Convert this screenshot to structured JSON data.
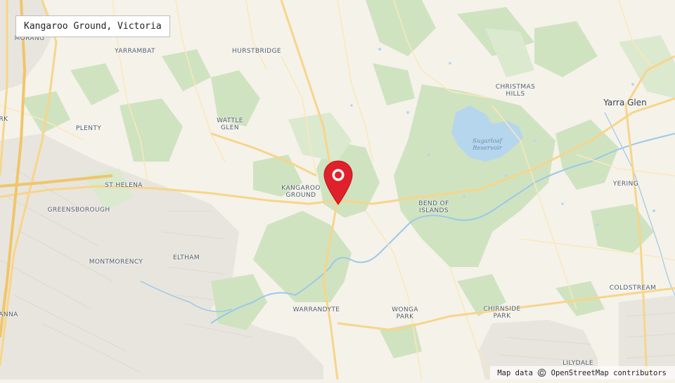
{
  "title": "Kangaroo Ground, Victoria",
  "attribution": "Map data ©️ OpenStreetMap contributors",
  "marker": {
    "label": "Kangaroo Ground",
    "color": "#e0212c",
    "icon": "map-pin-icon"
  },
  "reservoir": "Sugarloaf\nReservoir",
  "places": {
    "morang": "MORANG",
    "yarrambat": "YARRAMBAT",
    "hurstbridge": "HURSTBRIDGE",
    "christmas_hills": "CHRISTMAS\nHILLS",
    "yarra_glen": "Yarra Glen",
    "park_edge": "RK",
    "plenty": "PLENTY",
    "wattle_glen": "WATTLE\nGLEN",
    "st_helena": "ST HELENA",
    "kangaroo_ground": "KANGAROO\nGROUND",
    "yering": "YERING",
    "greensborough": "GREENSBOROUGH",
    "bend_of_islands": "BEND OF\nISLANDS",
    "montmorency": "MONTMORENCY",
    "eltham": "ELTHAM",
    "coldstream": "COLDSTREAM",
    "anna": "ANNA",
    "warrandyte": "WARRANDYTE",
    "wonga_park": "WONGA\nPARK",
    "chirnside_park": "CHIRNSIDE\nPARK",
    "lilydale": "LILYDALE"
  },
  "colors": {
    "land": "#f5f2ea",
    "forest": "#cfe3c0",
    "water": "#b6d6ee",
    "river": "#9cc9e9",
    "road_major": "#f7d58a",
    "road_minor": "#fbe8b9",
    "urban": "#e9e6df"
  }
}
